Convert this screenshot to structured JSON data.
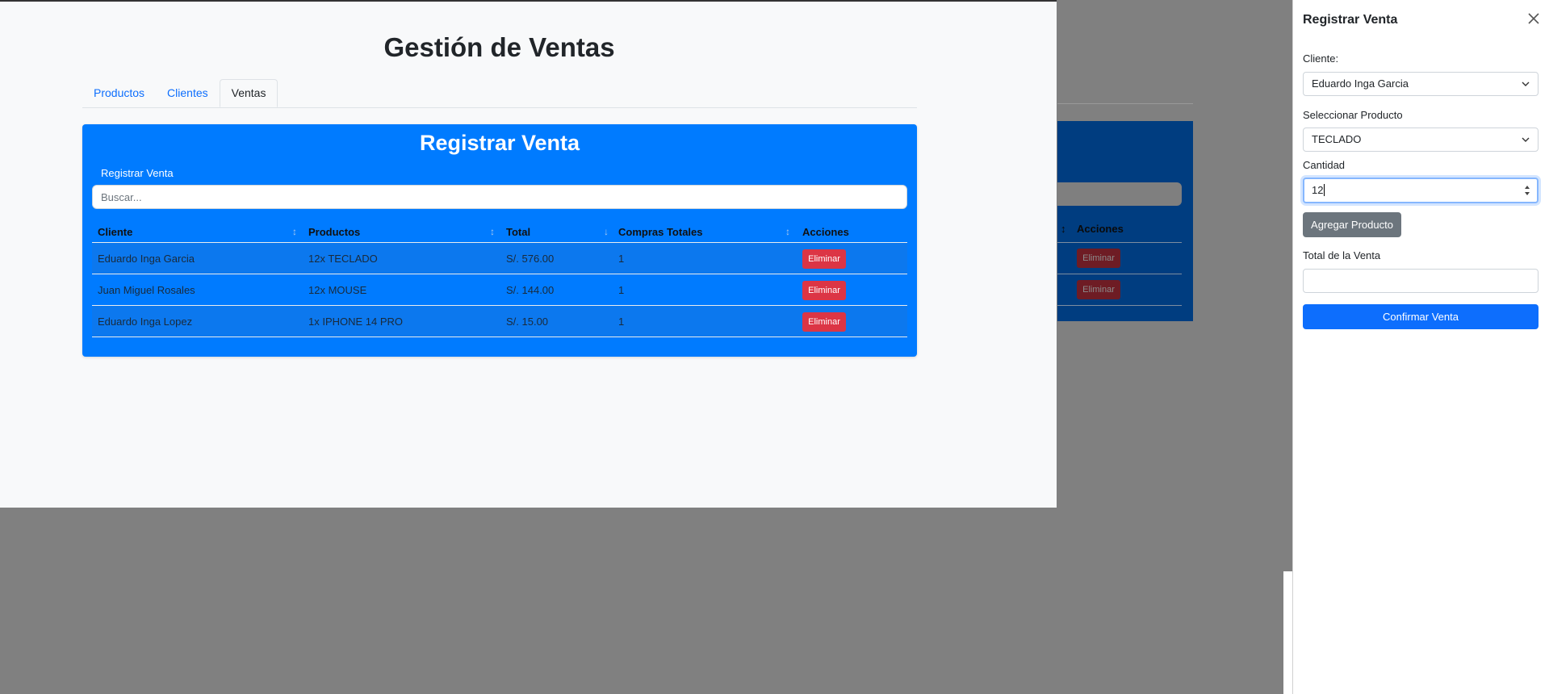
{
  "app": {
    "title": "Gestión de Ventas"
  },
  "tabs": [
    {
      "label": "Productos",
      "active": false
    },
    {
      "label": "Clientes",
      "active": false
    },
    {
      "label": "Ventas",
      "active": true
    }
  ],
  "card": {
    "title": "Registrar Venta",
    "subtitle": "Registrar Venta",
    "search_placeholder": "Buscar...",
    "columns": [
      "Cliente",
      "Productos",
      "Total",
      "Compras Totales",
      "Acciones"
    ],
    "rows": [
      {
        "cliente": "Eduardo Inga Garcia",
        "productos": "12x TECLADO",
        "total": "S/. 576.00",
        "compras": "1",
        "action": "Eliminar"
      },
      {
        "cliente": "Juan Miguel Rosales",
        "productos": "12x MOUSE",
        "total": "S/. 144.00",
        "compras": "1",
        "action": "Eliminar"
      },
      {
        "cliente": "Eduardo Inga Lopez",
        "productos": "1x IPHONE 14 PRO",
        "total": "S/. 15.00",
        "compras": "1",
        "action": "Eliminar"
      }
    ]
  },
  "background_copy": {
    "acciones_header": "Acciones",
    "eliminar": "Eliminar"
  },
  "panel": {
    "title": "Registrar Venta",
    "cliente_label": "Cliente:",
    "cliente_value": "Eduardo Inga Garcia",
    "producto_label": "Seleccionar Producto",
    "producto_value": "TECLADO",
    "cantidad_label": "Cantidad",
    "cantidad_value": "12",
    "add_button": "Agregar Producto",
    "total_label": "Total de la Venta",
    "total_value": "",
    "confirm_button": "Confirmar Venta"
  },
  "colors": {
    "accent": "#007bff",
    "primary_button": "#0d6efd",
    "danger": "#dc3545",
    "secondary": "#6c757d",
    "overlay": "#808080"
  }
}
